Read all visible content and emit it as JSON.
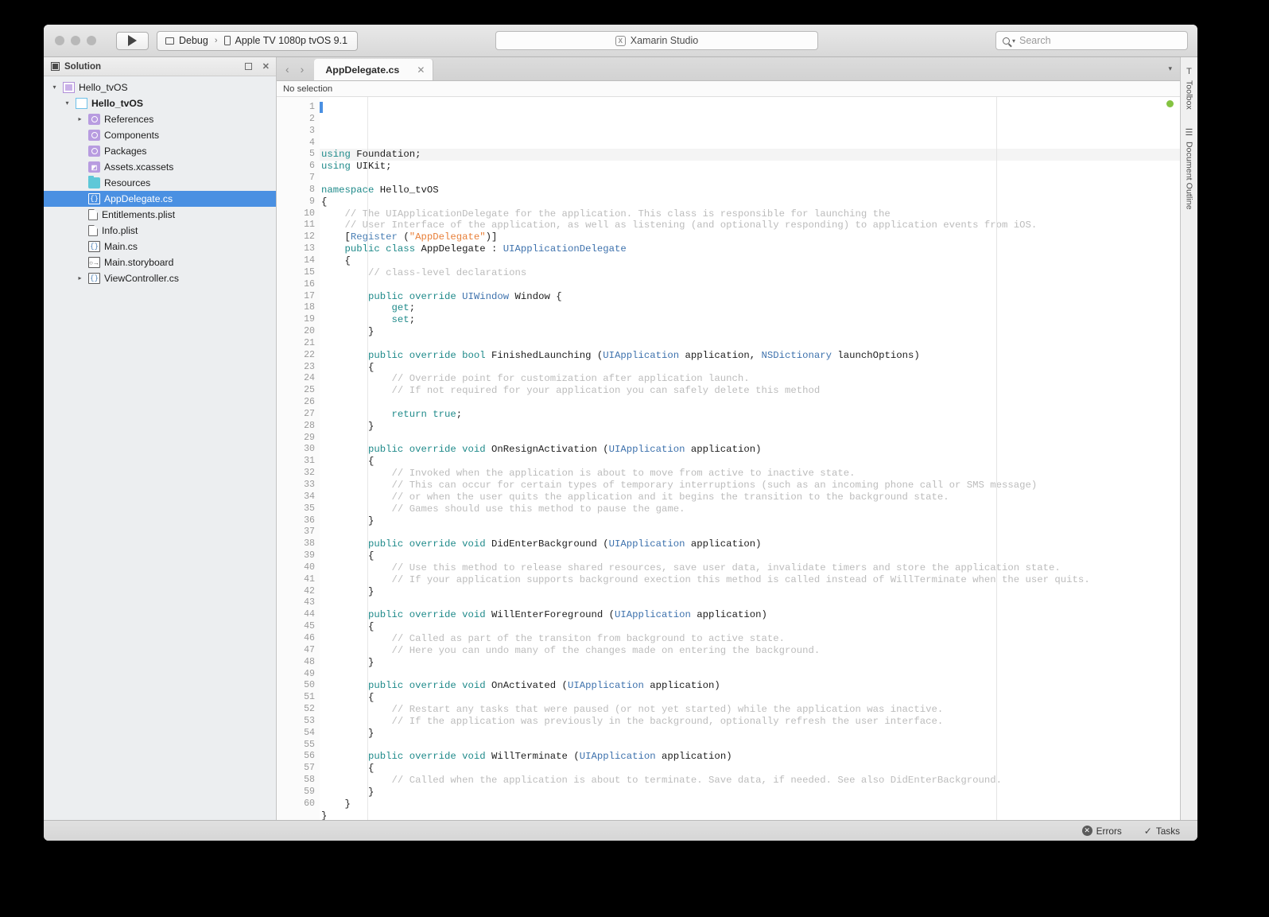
{
  "window": {
    "traffic_lights": [
      "close",
      "minimize",
      "zoom"
    ],
    "run_button": "run-button",
    "configuration": "Debug",
    "device": "Apple TV 1080p tvOS 9.1",
    "status_text": "Xamarin Studio",
    "search_placeholder": "Search"
  },
  "sidebar": {
    "title": "Solution",
    "tree": [
      {
        "label": "Hello_tvOS",
        "indent": 0,
        "twisty": "▾",
        "icon": "solution-icon",
        "bold": false,
        "selected": false
      },
      {
        "label": "Hello_tvOS",
        "indent": 1,
        "twisty": "▾",
        "icon": "project-icon",
        "bold": true,
        "selected": false
      },
      {
        "label": "References",
        "indent": 2,
        "twisty": "▸",
        "icon": "references-icon",
        "bold": false,
        "selected": false
      },
      {
        "label": "Components",
        "indent": 2,
        "twisty": "",
        "icon": "components-icon",
        "bold": false,
        "selected": false
      },
      {
        "label": "Packages",
        "indent": 2,
        "twisty": "",
        "icon": "packages-icon",
        "bold": false,
        "selected": false
      },
      {
        "label": "Assets.xcassets",
        "indent": 2,
        "twisty": "",
        "icon": "assets-icon",
        "bold": false,
        "selected": false
      },
      {
        "label": "Resources",
        "indent": 2,
        "twisty": "",
        "icon": "folder-icon",
        "bold": false,
        "selected": false
      },
      {
        "label": "AppDelegate.cs",
        "indent": 2,
        "twisty": "",
        "icon": "csharp-file-icon",
        "bold": false,
        "selected": true
      },
      {
        "label": "Entitlements.plist",
        "indent": 2,
        "twisty": "",
        "icon": "plist-file-icon",
        "bold": false,
        "selected": false
      },
      {
        "label": "Info.plist",
        "indent": 2,
        "twisty": "",
        "icon": "plist-file-icon",
        "bold": false,
        "selected": false
      },
      {
        "label": "Main.cs",
        "indent": 2,
        "twisty": "",
        "icon": "csharp-file-icon",
        "bold": false,
        "selected": false
      },
      {
        "label": "Main.storyboard",
        "indent": 2,
        "twisty": "",
        "icon": "storyboard-file-icon",
        "bold": false,
        "selected": false
      },
      {
        "label": "ViewController.cs",
        "indent": 2,
        "twisty": "▸",
        "icon": "csharp-file-icon",
        "bold": false,
        "selected": false
      }
    ]
  },
  "editor": {
    "tab_title": "AppDelegate.cs",
    "tab_close": "✕",
    "breadcrumb": "No selection",
    "back_arrow": "‹",
    "forward_arrow": "›",
    "tab_dropdown": "▾",
    "total_lines": 60,
    "code": [
      {
        "n": 1,
        "tokens": [
          [
            "k",
            "using"
          ],
          [
            "p",
            " Foundation;"
          ]
        ]
      },
      {
        "n": 2,
        "tokens": [
          [
            "k",
            "using"
          ],
          [
            "p",
            " UIKit;"
          ]
        ]
      },
      {
        "n": 3,
        "tokens": []
      },
      {
        "n": 4,
        "tokens": [
          [
            "k",
            "namespace"
          ],
          [
            "p",
            " Hello_tvOS"
          ]
        ]
      },
      {
        "n": 5,
        "tokens": [
          [
            "p",
            "{"
          ]
        ]
      },
      {
        "n": 6,
        "tokens": [
          [
            "c",
            "    // The UIApplicationDelegate for the application. This class is responsible for launching the"
          ]
        ]
      },
      {
        "n": 7,
        "tokens": [
          [
            "c",
            "    // User Interface of the application, as well as listening (and optionally responding) to application events from iOS."
          ]
        ]
      },
      {
        "n": 8,
        "tokens": [
          [
            "p",
            "    ["
          ],
          [
            "a",
            "Register"
          ],
          [
            "p",
            " ("
          ],
          [
            "s",
            "\"AppDelegate\""
          ],
          [
            "p",
            ")]"
          ]
        ]
      },
      {
        "n": 9,
        "tokens": [
          [
            "k",
            "    public class"
          ],
          [
            "p",
            " AppDelegate : "
          ],
          [
            "t",
            "UIApplicationDelegate"
          ]
        ]
      },
      {
        "n": 10,
        "tokens": [
          [
            "p",
            "    {"
          ]
        ]
      },
      {
        "n": 11,
        "tokens": [
          [
            "c",
            "        // class-level declarations"
          ]
        ]
      },
      {
        "n": 12,
        "tokens": []
      },
      {
        "n": 13,
        "tokens": [
          [
            "k",
            "        public override"
          ],
          [
            "p",
            " "
          ],
          [
            "t",
            "UIWindow"
          ],
          [
            "p",
            " Window {"
          ]
        ]
      },
      {
        "n": 14,
        "tokens": [
          [
            "k",
            "            get"
          ],
          [
            "p",
            ";"
          ]
        ]
      },
      {
        "n": 15,
        "tokens": [
          [
            "k",
            "            set"
          ],
          [
            "p",
            ";"
          ]
        ]
      },
      {
        "n": 16,
        "tokens": [
          [
            "p",
            "        }"
          ]
        ]
      },
      {
        "n": 17,
        "tokens": []
      },
      {
        "n": 18,
        "tokens": [
          [
            "k",
            "        public override bool"
          ],
          [
            "p",
            " FinishedLaunching ("
          ],
          [
            "t",
            "UIApplication"
          ],
          [
            "p",
            " application, "
          ],
          [
            "t",
            "NSDictionary"
          ],
          [
            "p",
            " launchOptions)"
          ]
        ]
      },
      {
        "n": 19,
        "tokens": [
          [
            "p",
            "        {"
          ]
        ]
      },
      {
        "n": 20,
        "tokens": [
          [
            "c",
            "            // Override point for customization after application launch."
          ]
        ]
      },
      {
        "n": 21,
        "tokens": [
          [
            "c",
            "            // If not required for your application you can safely delete this method"
          ]
        ]
      },
      {
        "n": 22,
        "tokens": []
      },
      {
        "n": 23,
        "tokens": [
          [
            "k",
            "            return true"
          ],
          [
            "p",
            ";"
          ]
        ]
      },
      {
        "n": 24,
        "tokens": [
          [
            "p",
            "        }"
          ]
        ]
      },
      {
        "n": 25,
        "tokens": []
      },
      {
        "n": 26,
        "tokens": [
          [
            "k",
            "        public override void"
          ],
          [
            "p",
            " OnResignActivation ("
          ],
          [
            "t",
            "UIApplication"
          ],
          [
            "p",
            " application)"
          ]
        ]
      },
      {
        "n": 27,
        "tokens": [
          [
            "p",
            "        {"
          ]
        ]
      },
      {
        "n": 28,
        "tokens": [
          [
            "c",
            "            // Invoked when the application is about to move from active to inactive state."
          ]
        ]
      },
      {
        "n": 29,
        "tokens": [
          [
            "c",
            "            // This can occur for certain types of temporary interruptions (such as an incoming phone call or SMS message)"
          ]
        ]
      },
      {
        "n": 30,
        "tokens": [
          [
            "c",
            "            // or when the user quits the application and it begins the transition to the background state."
          ]
        ]
      },
      {
        "n": 31,
        "tokens": [
          [
            "c",
            "            // Games should use this method to pause the game."
          ]
        ]
      },
      {
        "n": 32,
        "tokens": [
          [
            "p",
            "        }"
          ]
        ]
      },
      {
        "n": 33,
        "tokens": []
      },
      {
        "n": 34,
        "tokens": [
          [
            "k",
            "        public override void"
          ],
          [
            "p",
            " DidEnterBackground ("
          ],
          [
            "t",
            "UIApplication"
          ],
          [
            "p",
            " application)"
          ]
        ]
      },
      {
        "n": 35,
        "tokens": [
          [
            "p",
            "        {"
          ]
        ]
      },
      {
        "n": 36,
        "tokens": [
          [
            "c",
            "            // Use this method to release shared resources, save user data, invalidate timers and store the application state."
          ]
        ]
      },
      {
        "n": 37,
        "tokens": [
          [
            "c",
            "            // If your application supports background exection this method is called instead of WillTerminate when the user quits."
          ]
        ]
      },
      {
        "n": 38,
        "tokens": [
          [
            "p",
            "        }"
          ]
        ]
      },
      {
        "n": 39,
        "tokens": []
      },
      {
        "n": 40,
        "tokens": [
          [
            "k",
            "        public override void"
          ],
          [
            "p",
            " WillEnterForeground ("
          ],
          [
            "t",
            "UIApplication"
          ],
          [
            "p",
            " application)"
          ]
        ]
      },
      {
        "n": 41,
        "tokens": [
          [
            "p",
            "        {"
          ]
        ]
      },
      {
        "n": 42,
        "tokens": [
          [
            "c",
            "            // Called as part of the transiton from background to active state."
          ]
        ]
      },
      {
        "n": 43,
        "tokens": [
          [
            "c",
            "            // Here you can undo many of the changes made on entering the background."
          ]
        ]
      },
      {
        "n": 44,
        "tokens": [
          [
            "p",
            "        }"
          ]
        ]
      },
      {
        "n": 45,
        "tokens": []
      },
      {
        "n": 46,
        "tokens": [
          [
            "k",
            "        public override void"
          ],
          [
            "p",
            " OnActivated ("
          ],
          [
            "t",
            "UIApplication"
          ],
          [
            "p",
            " application)"
          ]
        ]
      },
      {
        "n": 47,
        "tokens": [
          [
            "p",
            "        {"
          ]
        ]
      },
      {
        "n": 48,
        "tokens": [
          [
            "c",
            "            // Restart any tasks that were paused (or not yet started) while the application was inactive."
          ]
        ]
      },
      {
        "n": 49,
        "tokens": [
          [
            "c",
            "            // If the application was previously in the background, optionally refresh the user interface."
          ]
        ]
      },
      {
        "n": 50,
        "tokens": [
          [
            "p",
            "        }"
          ]
        ]
      },
      {
        "n": 51,
        "tokens": []
      },
      {
        "n": 52,
        "tokens": [
          [
            "k",
            "        public override void"
          ],
          [
            "p",
            " WillTerminate ("
          ],
          [
            "t",
            "UIApplication"
          ],
          [
            "p",
            " application)"
          ]
        ]
      },
      {
        "n": 53,
        "tokens": [
          [
            "p",
            "        {"
          ]
        ]
      },
      {
        "n": 54,
        "tokens": [
          [
            "c",
            "            // Called when the application is about to terminate. Save data, if needed. See also DidEnterBackground."
          ]
        ]
      },
      {
        "n": 55,
        "tokens": [
          [
            "p",
            "        }"
          ]
        ]
      },
      {
        "n": 56,
        "tokens": [
          [
            "p",
            "    }"
          ]
        ]
      },
      {
        "n": 57,
        "tokens": [
          [
            "p",
            "}"
          ]
        ]
      },
      {
        "n": 58,
        "tokens": []
      },
      {
        "n": 59,
        "tokens": []
      },
      {
        "n": 60,
        "tokens": []
      }
    ]
  },
  "right_pads": [
    {
      "label": "Toolbox",
      "glyph": "T"
    },
    {
      "label": "Document Outline",
      "glyph": "☰"
    }
  ],
  "statusbar": {
    "errors_label": "Errors",
    "errors_glyph": "✕",
    "tasks_label": "Tasks",
    "tasks_glyph": "✓"
  },
  "colors": {
    "selection_blue": "#4a90e2",
    "keyword": "#1f8a8a",
    "type": "#3e72ad",
    "comment": "#bcbcbc",
    "string": "#e8803a",
    "green_dot": "#84c341"
  }
}
